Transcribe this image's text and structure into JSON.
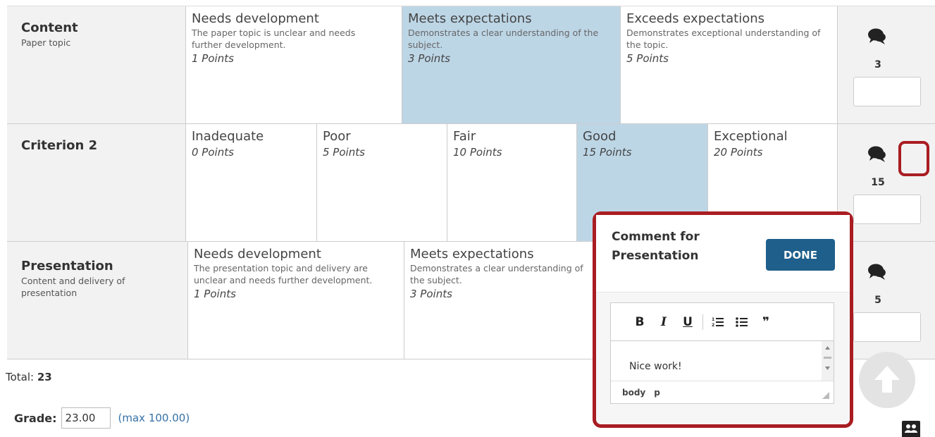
{
  "rows": [
    {
      "title": "Content",
      "description": "Paper topic",
      "ratings": [
        {
          "title": "Needs development",
          "description": "The paper topic is unclear and needs further development.",
          "points": "1 Points"
        },
        {
          "title": "Meets expectations",
          "description": "Demonstrates a clear understanding of the subject.",
          "points": "3 Points",
          "selected": true
        },
        {
          "title": "Exceeds expectations",
          "description": "Demonstrates exceptional understanding of the topic.",
          "points": "5 Points"
        }
      ],
      "score": "3"
    },
    {
      "title": "Criterion 2",
      "description": "",
      "ratings": [
        {
          "title": "Inadequate",
          "points": "0 Points"
        },
        {
          "title": "Poor",
          "points": "5 Points"
        },
        {
          "title": "Fair",
          "points": "10 Points"
        },
        {
          "title": "Good",
          "points": "15 Points",
          "selected": true
        },
        {
          "title": "Exceptional",
          "points": "20 Points"
        }
      ],
      "score": "15"
    },
    {
      "title": "Presentation",
      "description": "Content and delivery of presentation",
      "ratings": [
        {
          "title": "Needs development",
          "description": "The presentation topic and delivery are unclear and needs further development.",
          "points": "1 Points"
        },
        {
          "title": "Meets expectations",
          "description": "Demonstrates a clear understanding of the subject.",
          "points": "3 Points"
        }
      ],
      "score": "5"
    }
  ],
  "total": {
    "label": "Total:",
    "value": "23"
  },
  "grade": {
    "label": "Grade:",
    "value": "23.00",
    "max": "(max 100.00)"
  },
  "popup": {
    "title": "Comment for Presentation",
    "done": "DONE",
    "toolbar": {
      "bold": "B",
      "italic": "I",
      "underline": "U",
      "quote": "❞"
    },
    "content": "Nice work!",
    "path": [
      "body",
      "p"
    ]
  },
  "colors": {
    "selected": "#bdd6e6",
    "accent": "#1f5f8b",
    "highlight": "#a91d22"
  }
}
